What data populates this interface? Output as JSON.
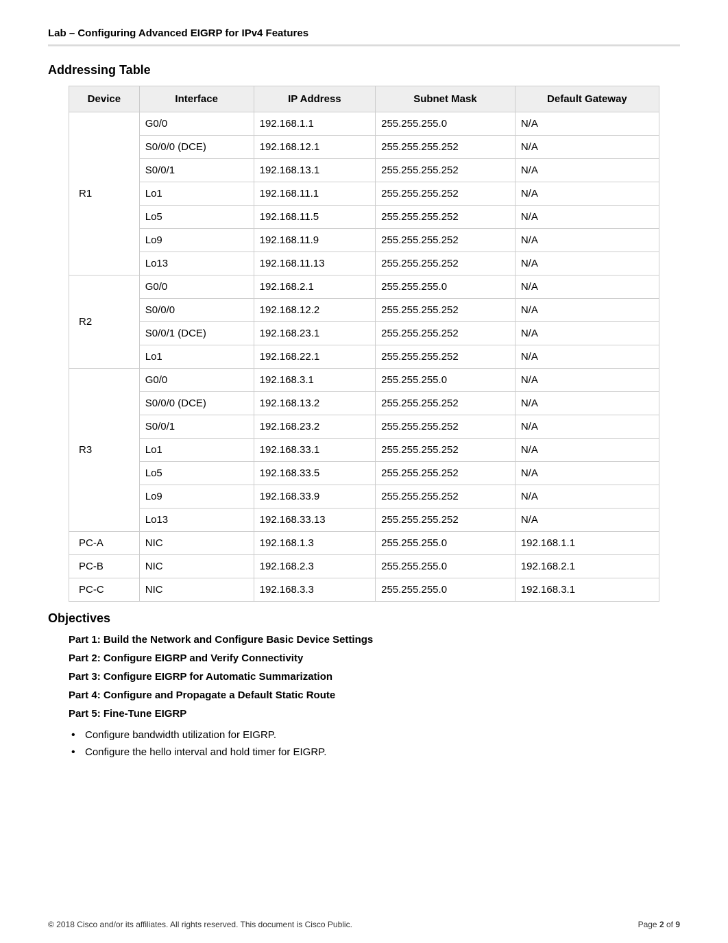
{
  "header": {
    "title": "Lab – Configuring Advanced EIGRP for IPv4 Features"
  },
  "sections": {
    "addressing_title": "Addressing Table",
    "objectives_title": "Objectives"
  },
  "table": {
    "headers": {
      "device": "Device",
      "interface": "Interface",
      "ip": "IP Address",
      "mask": "Subnet Mask",
      "gateway": "Default Gateway"
    },
    "groups": [
      {
        "device": "R1",
        "rows": [
          {
            "iface": "G0/0",
            "ip": "192.168.1.1",
            "mask": "255.255.255.0",
            "gw": "N/A"
          },
          {
            "iface": "S0/0/0 (DCE)",
            "ip": "192.168.12.1",
            "mask": "255.255.255.252",
            "gw": "N/A"
          },
          {
            "iface": "S0/0/1",
            "ip": "192.168.13.1",
            "mask": "255.255.255.252",
            "gw": "N/A"
          },
          {
            "iface": "Lo1",
            "ip": "192.168.11.1",
            "mask": "255.255.255.252",
            "gw": "N/A"
          },
          {
            "iface": "Lo5",
            "ip": "192.168.11.5",
            "mask": "255.255.255.252",
            "gw": "N/A"
          },
          {
            "iface": "Lo9",
            "ip": "192.168.11.9",
            "mask": "255.255.255.252",
            "gw": "N/A"
          },
          {
            "iface": "Lo13",
            "ip": "192.168.11.13",
            "mask": "255.255.255.252",
            "gw": "N/A"
          }
        ]
      },
      {
        "device": "R2",
        "rows": [
          {
            "iface": "G0/0",
            "ip": "192.168.2.1",
            "mask": "255.255.255.0",
            "gw": "N/A"
          },
          {
            "iface": "S0/0/0",
            "ip": "192.168.12.2",
            "mask": "255.255.255.252",
            "gw": "N/A"
          },
          {
            "iface": "S0/0/1 (DCE)",
            "ip": "192.168.23.1",
            "mask": "255.255.255.252",
            "gw": "N/A"
          },
          {
            "iface": "Lo1",
            "ip": "192.168.22.1",
            "mask": "255.255.255.252",
            "gw": "N/A"
          }
        ]
      },
      {
        "device": "R3",
        "rows": [
          {
            "iface": "G0/0",
            "ip": "192.168.3.1",
            "mask": "255.255.255.0",
            "gw": "N/A"
          },
          {
            "iface": "S0/0/0 (DCE)",
            "ip": "192.168.13.2",
            "mask": "255.255.255.252",
            "gw": "N/A"
          },
          {
            "iface": "S0/0/1",
            "ip": "192.168.23.2",
            "mask": "255.255.255.252",
            "gw": "N/A"
          },
          {
            "iface": "Lo1",
            "ip": "192.168.33.1",
            "mask": "255.255.255.252",
            "gw": "N/A"
          },
          {
            "iface": "Lo5",
            "ip": "192.168.33.5",
            "mask": "255.255.255.252",
            "gw": "N/A"
          },
          {
            "iface": "Lo9",
            "ip": "192.168.33.9",
            "mask": "255.255.255.252",
            "gw": "N/A"
          },
          {
            "iface": "Lo13",
            "ip": "192.168.33.13",
            "mask": "255.255.255.252",
            "gw": "N/A"
          }
        ]
      },
      {
        "device": "PC-A",
        "rows": [
          {
            "iface": "NIC",
            "ip": "192.168.1.3",
            "mask": "255.255.255.0",
            "gw": "192.168.1.1"
          }
        ]
      },
      {
        "device": "PC-B",
        "rows": [
          {
            "iface": "NIC",
            "ip": "192.168.2.3",
            "mask": "255.255.255.0",
            "gw": "192.168.2.1"
          }
        ]
      },
      {
        "device": "PC-C",
        "rows": [
          {
            "iface": "NIC",
            "ip": "192.168.3.3",
            "mask": "255.255.255.0",
            "gw": "192.168.3.1"
          }
        ]
      }
    ]
  },
  "objectives": {
    "parts": [
      "Part 1: Build the Network and Configure Basic Device Settings",
      "Part 2: Configure EIGRP and Verify Connectivity",
      "Part 3: Configure EIGRP for Automatic Summarization",
      "Part 4: Configure and Propagate a Default Static Route",
      "Part 5: Fine-Tune EIGRP"
    ],
    "bullets": [
      "Configure bandwidth utilization for EIGRP.",
      "Configure the hello interval and hold timer for EIGRP."
    ]
  },
  "footer": {
    "copyright": "© 2018 Cisco and/or its affiliates. All rights reserved. This document is Cisco Public.",
    "page_label": "Page ",
    "page_current": "2",
    "page_of": " of ",
    "page_total": "9"
  }
}
